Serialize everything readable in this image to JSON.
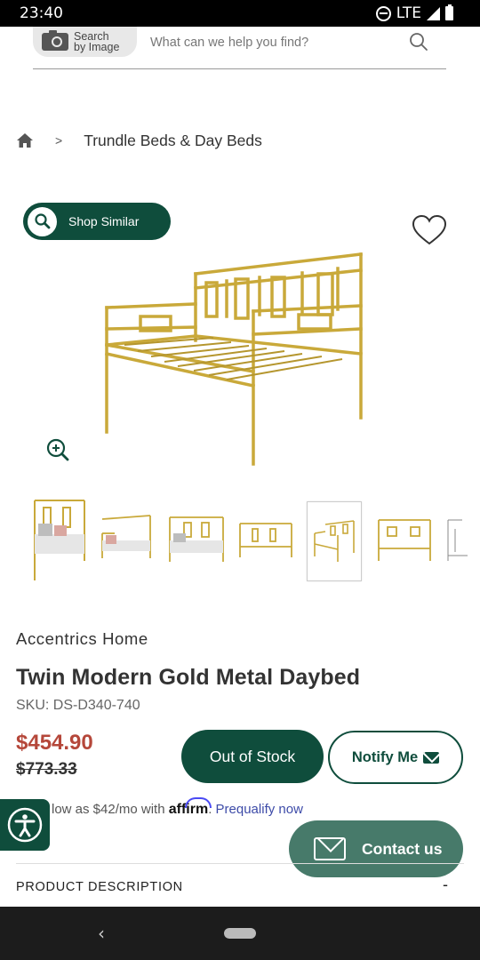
{
  "status_bar": {
    "time": "23:40",
    "network": "LTE"
  },
  "search": {
    "image_search_label": "Search\nby Image",
    "placeholder": "What can we help you find?"
  },
  "breadcrumb": {
    "separator": ">",
    "category": "Trundle Beds & Day Beds"
  },
  "shop_similar_label": "Shop Similar",
  "product": {
    "brand": "Accentrics Home",
    "title": "Twin Modern Gold Metal Daybed",
    "sku": "SKU: DS-D340-740",
    "price_sale": "$454.90",
    "price_original": "$773.33",
    "thumbnail_count": 7,
    "selected_thumbnail": 5
  },
  "buttons": {
    "out_of_stock": "Out of Stock",
    "notify_me": "Notify Me"
  },
  "affirm": {
    "text": "low as $42/mo with ",
    "logo": "affirm",
    "after_logo": ". ",
    "prequalify": "Prequalify now"
  },
  "contact_label": "Contact us",
  "description": {
    "label": "PRODUCT DESCRIPTION",
    "toggle": "-"
  },
  "colors": {
    "brand_green": "#0f4d3c",
    "sale_red": "#b5473a",
    "gold": "#c9a93a"
  }
}
